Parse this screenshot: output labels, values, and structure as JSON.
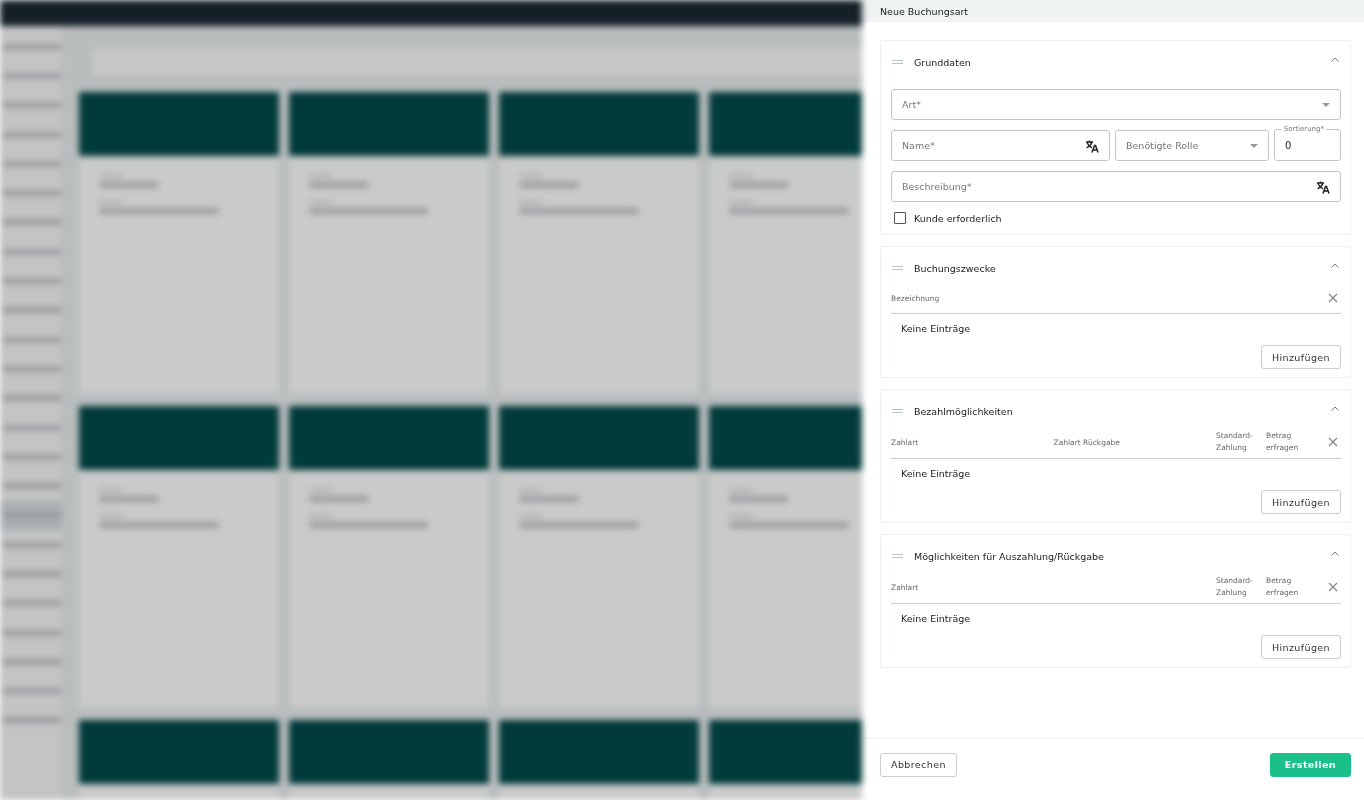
{
  "panel_title": "Neue Buchungsart",
  "sections": [
    {
      "kind": "form",
      "title": "Grunddaten",
      "expanded": true,
      "rows": [
        [
          {
            "kind": "select",
            "placeholder": "Art*"
          }
        ],
        [
          {
            "kind": "text",
            "placeholder": "Name*",
            "translatable": true
          },
          {
            "kind": "select",
            "placeholder": "Benötigte Rolle"
          },
          {
            "kind": "number",
            "label": "Sortierung*",
            "value": "0"
          }
        ],
        [
          {
            "kind": "text",
            "placeholder": "Beschreibung*",
            "translatable": true
          }
        ]
      ],
      "checkbox": {
        "label": "Kunde erforderlich",
        "checked": false
      }
    },
    {
      "kind": "table",
      "title": "Buchungszwecke",
      "expanded": true,
      "columns": [
        {
          "kind": "text",
          "label": "Bezeichnung"
        }
      ],
      "empty_text": "Keine Einträge",
      "add_button": "Hinzufügen"
    },
    {
      "kind": "table",
      "title": "Bezahlmöglichkeiten",
      "expanded": true,
      "columns": [
        {
          "kind": "text",
          "label": "Zahlart"
        },
        {
          "kind": "text",
          "label": "Zahlart Rückgabe"
        },
        {
          "kind": "flag",
          "label": "Standard-Zahlung"
        },
        {
          "kind": "flag",
          "label": "Betrag erfragen"
        }
      ],
      "empty_text": "Keine Einträge",
      "add_button": "Hinzufügen"
    },
    {
      "kind": "table",
      "title": "Möglichkeiten für Auszahlung/Rückgabe",
      "expanded": true,
      "columns": [
        {
          "kind": "text",
          "label": "Zahlart"
        },
        {
          "kind": "flag",
          "label": "Standard-Zahlung"
        },
        {
          "kind": "flag",
          "label": "Betrag erfragen"
        }
      ],
      "empty_text": "Keine Einträge",
      "add_button": "Hinzufügen"
    }
  ],
  "footer": {
    "cancel": "Abbrechen",
    "submit": "Erstellen"
  }
}
